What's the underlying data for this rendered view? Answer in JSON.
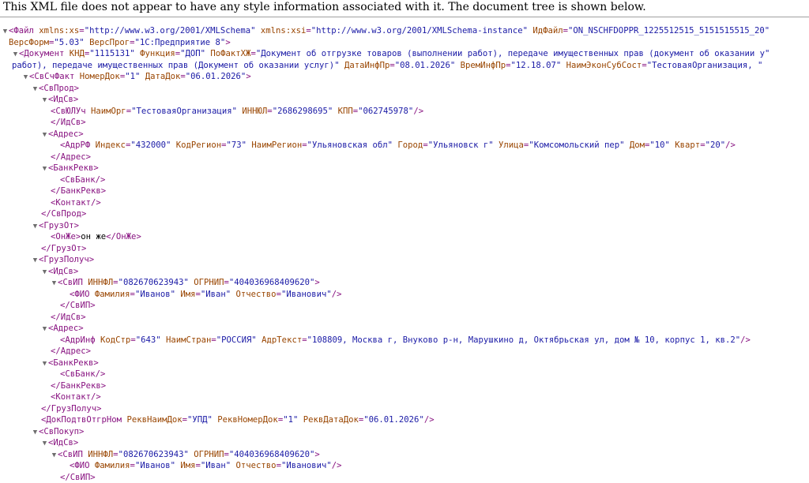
{
  "notice": "This XML file does not appear to have any style information associated with it. The document tree is shown below.",
  "tree": [
    {
      "lv": "l0",
      "ar": 1,
      "t": "<Файл",
      "a": [
        [
          "xmlns:xs",
          "http://www.w3.org/2001/XMLSchema"
        ],
        [
          "xmlns:xsi",
          "http://www.w3.org/2001/XMLSchema-instance"
        ],
        [
          "ИдФайл",
          "ON_NSCHFDOPPR_1225512515_5151515515_20"
        ]
      ],
      "e": ""
    },
    {
      "lv": "l0c",
      "a": [
        [
          "ВерсФорм",
          "5.03"
        ],
        [
          "ВерсПрог",
          "1С:Предприятие 8"
        ]
      ],
      "e": ">"
    },
    {
      "lv": "l1",
      "ar": 1,
      "t": "<Документ",
      "a": [
        [
          "КНД",
          "1115131"
        ],
        [
          "Функция",
          "ДОП"
        ],
        [
          "ПоФактХЖ",
          "Документ об отгрузке товаров (выполнении работ), передаче имущественных прав (документ об оказании у"
        ]
      ],
      "e": ""
    },
    {
      "lv": "l1",
      "raw": "работ), передаче имущественных прав (Документ об оказании услуг)\"",
      "a": [
        [
          "ДатаИнфПр",
          "08.01.2026"
        ],
        [
          "ВремИнфПр",
          "12.18.07"
        ],
        [
          "НаимЭконСубСост",
          "ТестоваяОрганизация, "
        ]
      ],
      "e": ""
    },
    {
      "lv": "l2",
      "ar": 1,
      "t": "<СвСчФакт",
      "a": [
        [
          "НомерДок",
          "1"
        ],
        [
          "ДатаДок",
          "06.01.2026"
        ]
      ],
      "e": ">"
    },
    {
      "lv": "l3",
      "ar": 1,
      "t": "<СвПрод>"
    },
    {
      "lv": "l4",
      "ar": 1,
      "t": "<ИдСв>"
    },
    {
      "lv": "l5",
      "t": "<СвЮЛУч",
      "a": [
        [
          "НаимОрг",
          "ТестоваяОрганизация"
        ],
        [
          "ИННЮЛ",
          "2686298695"
        ],
        [
          "КПП",
          "062745978"
        ]
      ],
      "e": "/>"
    },
    {
      "lv": "l5",
      "t": "</ИдСв>"
    },
    {
      "lv": "l4",
      "ar": 1,
      "t": "<Адрес>"
    },
    {
      "lv": "l6",
      "t": "<АдрРФ",
      "a": [
        [
          "Индекс",
          "432000"
        ],
        [
          "КодРегион",
          "73"
        ],
        [
          "НаимРегион",
          "Ульяновская обл"
        ],
        [
          "Город",
          "Ульяновск г"
        ],
        [
          "Улица",
          "Комсомольский пер"
        ],
        [
          "Дом",
          "10"
        ],
        [
          "Кварт",
          "20"
        ]
      ],
      "e": "/>"
    },
    {
      "lv": "l5",
      "t": "</Адрес>"
    },
    {
      "lv": "l4",
      "ar": 1,
      "t": "<БанкРекв>"
    },
    {
      "lv": "l6",
      "t": "<СвБанк/>"
    },
    {
      "lv": "l5",
      "t": "</БанкРекв>"
    },
    {
      "lv": "l5",
      "t": "<Контакт/>"
    },
    {
      "lv": "l4",
      "t": "</СвПрод>"
    },
    {
      "lv": "l3",
      "ar": 1,
      "t": "<ГрузОт>"
    },
    {
      "lv": "l5",
      "t": "<ОнЖе>",
      "x": "он же",
      "t2": "</ОнЖе>"
    },
    {
      "lv": "l4",
      "t": "</ГрузОт>"
    },
    {
      "lv": "l3",
      "ar": 1,
      "t": "<ГрузПолуч>"
    },
    {
      "lv": "l4",
      "ar": 1,
      "t": "<ИдСв>"
    },
    {
      "lv": "l5",
      "ar": 1,
      "t": "<СвИП",
      "a": [
        [
          "ИННФЛ",
          "082670623943"
        ],
        [
          "ОГРНИП",
          "404036968409620"
        ]
      ],
      "e": ">"
    },
    {
      "lv": "l7",
      "t": "<ФИО",
      "a": [
        [
          "Фамилия",
          "Иванов"
        ],
        [
          "Имя",
          "Иван"
        ],
        [
          "Отчество",
          "Иванович"
        ]
      ],
      "e": "/>"
    },
    {
      "lv": "l6",
      "t": "</СвИП>"
    },
    {
      "lv": "l5",
      "t": "</ИдСв>"
    },
    {
      "lv": "l4",
      "ar": 1,
      "t": "<Адрес>"
    },
    {
      "lv": "l6",
      "t": "<АдрИнф",
      "a": [
        [
          "КодСтр",
          "643"
        ],
        [
          "НаимСтран",
          "РОССИЯ"
        ],
        [
          "АдрТекст",
          "108809, Москва г, Внуково р-н, Марушкино д, Октябрьская ул, дом № 10, корпус 1, кв.2"
        ]
      ],
      "e": "/>"
    },
    {
      "lv": "l5",
      "t": "</Адрес>"
    },
    {
      "lv": "l4",
      "ar": 1,
      "t": "<БанкРекв>"
    },
    {
      "lv": "l6",
      "t": "<СвБанк/>"
    },
    {
      "lv": "l5",
      "t": "</БанкРекв>"
    },
    {
      "lv": "l5",
      "t": "<Контакт/>"
    },
    {
      "lv": "l4",
      "t": "</ГрузПолуч>"
    },
    {
      "lv": "l4",
      "t": "<ДокПодтвОтгрНом",
      "a": [
        [
          "РеквНаимДок",
          "УПД"
        ],
        [
          "РеквНомерДок",
          "1"
        ],
        [
          "РеквДатаДок",
          "06.01.2026"
        ]
      ],
      "e": "/>"
    },
    {
      "lv": "l3",
      "ar": 1,
      "t": "<СвПокуп>"
    },
    {
      "lv": "l4",
      "ar": 1,
      "t": "<ИдСв>"
    },
    {
      "lv": "l5",
      "ar": 1,
      "t": "<СвИП",
      "a": [
        [
          "ИННФЛ",
          "082670623943"
        ],
        [
          "ОГРНИП",
          "404036968409620"
        ]
      ],
      "e": ">"
    },
    {
      "lv": "l7",
      "t": "<ФИО",
      "a": [
        [
          "Фамилия",
          "Иванов"
        ],
        [
          "Имя",
          "Иван"
        ],
        [
          "Отчество",
          "Иванович"
        ]
      ],
      "e": "/>"
    },
    {
      "lv": "l6",
      "t": "</СвИП>"
    }
  ]
}
